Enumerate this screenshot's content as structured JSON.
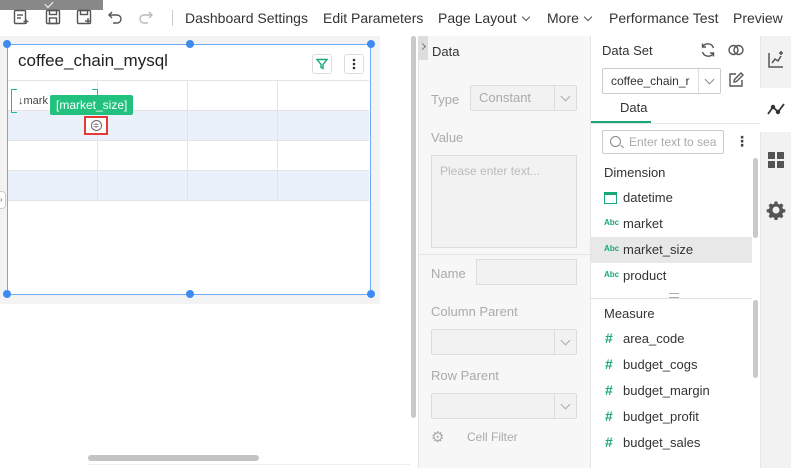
{
  "toolbar": {
    "menus": [
      {
        "label": "Dashboard Settings",
        "dropdown": false
      },
      {
        "label": "Edit Parameters",
        "dropdown": false
      },
      {
        "label": "Page Layout",
        "dropdown": true
      },
      {
        "label": "More",
        "dropdown": true
      },
      {
        "label": "Performance Test",
        "dropdown": false
      },
      {
        "label": "Preview",
        "dropdown": false
      }
    ],
    "icons": [
      "new-icon",
      "save-icon",
      "save-as-icon",
      "undo-icon",
      "redo-icon"
    ]
  },
  "widget": {
    "title": "coffee_chain_mysql",
    "cell_text": "↓mark",
    "field_tag": "[market_size]",
    "filter_icon": "filter-icon",
    "more_icon": "more-icon",
    "expand_icon": "expand-icon"
  },
  "properties": {
    "title": "Data",
    "type_label": "Type",
    "type_value": "Constant",
    "value_label": "Value",
    "value_placeholder": "Please enter text...",
    "name_label": "Name",
    "column_parent_label": "Column Parent",
    "row_parent_label": "Row Parent",
    "cell_filter_label": "Cell Filter"
  },
  "data_panel": {
    "title": "Data Set",
    "dataset_value": "coffee_chain_r",
    "tab": "Data",
    "search_placeholder": "Enter text to sea",
    "dimension_header": "Dimension",
    "dimensions": [
      {
        "name": "datetime",
        "icon": "calendar-icon",
        "selected": false
      },
      {
        "name": "market",
        "icon": "text-icon",
        "selected": false
      },
      {
        "name": "market_size",
        "icon": "text-icon",
        "selected": true
      },
      {
        "name": "product",
        "icon": "text-icon",
        "selected": false
      }
    ],
    "measure_header": "Measure",
    "measures": [
      {
        "name": "area_code"
      },
      {
        "name": "budget_cogs"
      },
      {
        "name": "budget_margin"
      },
      {
        "name": "budget_profit"
      },
      {
        "name": "budget_sales"
      }
    ],
    "text_icon_glyph": "Abc",
    "number_icon_glyph": "#"
  },
  "rail": [
    "chart-add-icon",
    "trend-icon",
    "components-icon",
    "settings-icon"
  ],
  "colors": {
    "accent": "#1aa87a",
    "selection": "#3d8bf2",
    "tag": "#22c27e",
    "highlight": "#e53935"
  }
}
